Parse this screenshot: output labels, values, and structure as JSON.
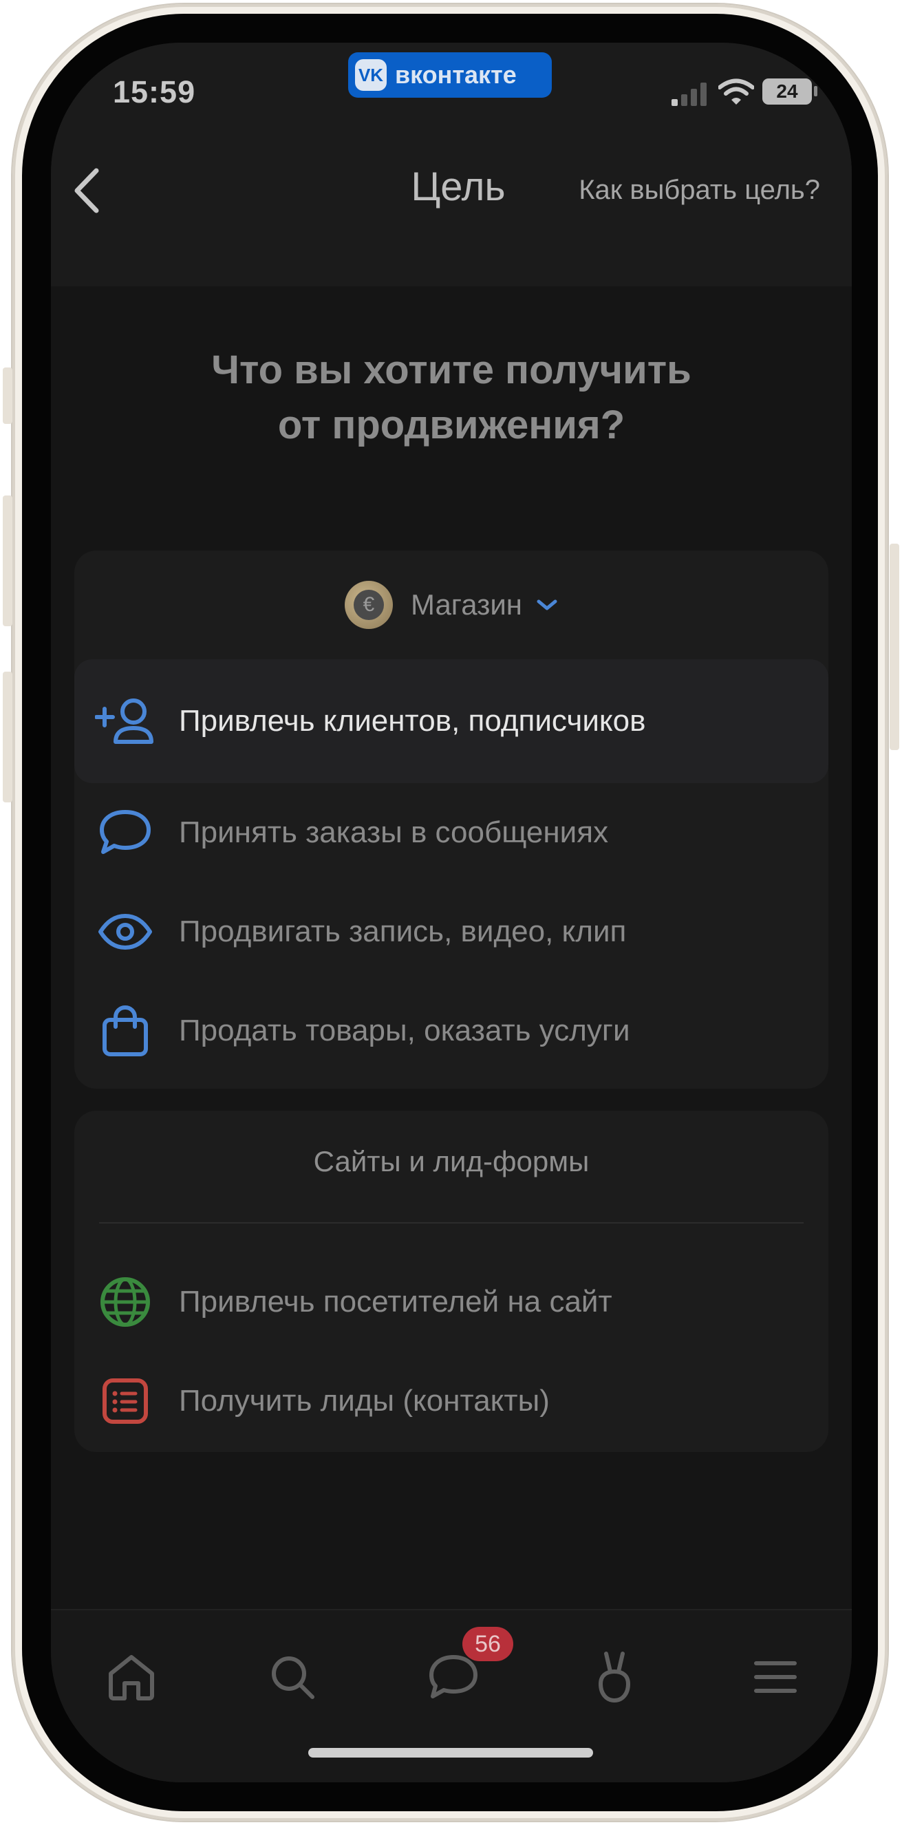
{
  "status_bar": {
    "time": "15:59",
    "app_pill": "вконтакте",
    "app_pill_logo": "VK",
    "battery": "24"
  },
  "nav": {
    "title": "Цель",
    "help_link": "Как выбрать цель?"
  },
  "headline": {
    "line1": "Что вы хотите получить",
    "line2": "от продвижения?"
  },
  "goals_card": {
    "category": {
      "label": "Магазин",
      "icon": "euro-coin-icon"
    },
    "items": [
      {
        "label": "Привлечь клиентов, подписчиков",
        "icon": "add-user-icon",
        "selected": true
      },
      {
        "label": "Принять заказы в сообщениях",
        "icon": "chat-bubble-icon",
        "selected": false
      },
      {
        "label": "Продвигать запись, видео, клип",
        "icon": "eye-icon",
        "selected": false
      },
      {
        "label": "Продать товары, оказать услуги",
        "icon": "shopping-bag-icon",
        "selected": false
      }
    ]
  },
  "sites_card": {
    "title": "Сайты и лид-формы",
    "items": [
      {
        "label": "Привлечь посетителей на сайт",
        "icon": "globe-icon"
      },
      {
        "label": "Получить лиды (контакты)",
        "icon": "list-form-icon"
      }
    ]
  },
  "tab_bar": {
    "messages_badge": "56",
    "tabs": [
      "home-icon",
      "search-icon",
      "messages-icon",
      "clips-icon",
      "menu-icon"
    ]
  },
  "colors": {
    "accent_blue": "#4a86d6",
    "vk_blue": "#0a5fc7",
    "globe_green": "#3a8a3e",
    "leads_red": "#c2473f",
    "badge_red": "#b8303a",
    "background": "#151515",
    "card": "#1c1c1c"
  }
}
